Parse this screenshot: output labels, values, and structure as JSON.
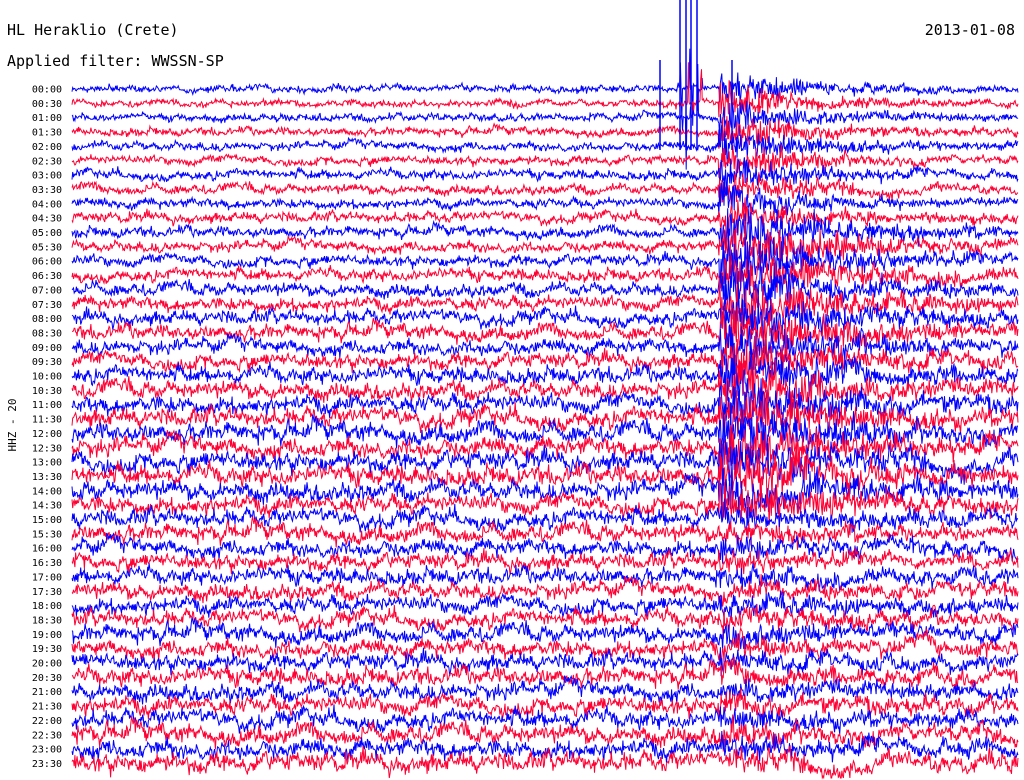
{
  "header": {
    "station": "HL Heraklio (Crete)",
    "date": "2013-01-08",
    "filter": "Applied filter: WWSSN-SP"
  },
  "chart_data": {
    "type": "line",
    "title": "HL Heraklio (Crete)",
    "date": "2013-01-08",
    "filter": "WWSSN-SP",
    "ylabel": "HHZ - 20",
    "tick_labels": [
      "00:00",
      "00:30",
      "01:00",
      "01:30",
      "02:00",
      "02:30",
      "03:00",
      "03:30",
      "04:00",
      "04:30",
      "05:00",
      "05:30",
      "06:00",
      "06:30",
      "07:00",
      "07:30",
      "08:00",
      "08:30",
      "09:00",
      "09:30",
      "10:00",
      "10:30",
      "11:00",
      "11:30",
      "12:00",
      "12:30",
      "13:00",
      "13:30",
      "14:00",
      "14:30",
      "15:00",
      "15:30",
      "16:00",
      "16:30",
      "17:00",
      "17:30",
      "18:00",
      "18:30",
      "19:00",
      "19:30",
      "20:00",
      "20:30",
      "21:00",
      "21:30",
      "22:00",
      "22:30",
      "23:00",
      "23:30"
    ],
    "x_unit": "minutes",
    "xlim": [
      0,
      30
    ],
    "trace_colors": [
      "#0000ff",
      "#ff0033"
    ],
    "series": [
      {
        "values": [
          0.15,
          0.15,
          0.2,
          0.2,
          0.25,
          0.25,
          0.3,
          0.3,
          0.32,
          0.35,
          0.35,
          0.38,
          0.4,
          0.45,
          0.5,
          0.55,
          0.6,
          0.6,
          0.62,
          0.65,
          0.7,
          0.75,
          0.8,
          0.85,
          0.85,
          0.88,
          0.9,
          0.9,
          0.88,
          0.8,
          0.78,
          0.75,
          0.72,
          0.7,
          0.7,
          0.7,
          0.72,
          0.72,
          0.75,
          0.75,
          0.75,
          0.78,
          0.78,
          0.8,
          0.8,
          0.82,
          0.85,
          0.9
        ]
      }
    ],
    "events": [
      {
        "label": "",
        "start_minute": 20.5,
        "line_from": 0,
        "line_to": 47
      }
    ]
  },
  "colors": {
    "trace_a": "#0000ff",
    "trace_b": "#ff0033",
    "background": "#ffffff",
    "text": "#000000"
  }
}
